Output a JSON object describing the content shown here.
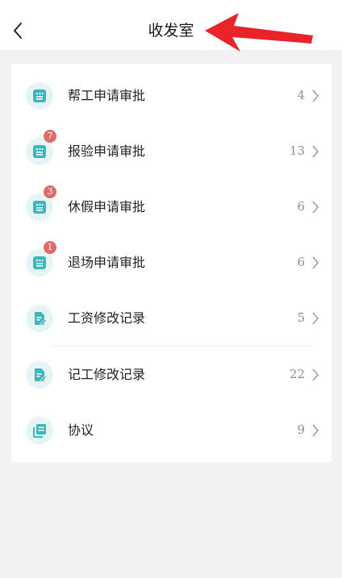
{
  "header": {
    "title": "收发室"
  },
  "items": [
    {
      "label": "帮工申请审批",
      "count": "4",
      "badge": "",
      "icon": "doc-list-icon"
    },
    {
      "label": "报验申请审批",
      "count": "13",
      "badge": "7",
      "icon": "doc-list-icon"
    },
    {
      "label": "休假申请审批",
      "count": "6",
      "badge": "3",
      "icon": "doc-list-icon"
    },
    {
      "label": "退场申请审批",
      "count": "6",
      "badge": "1",
      "icon": "doc-list-icon"
    },
    {
      "label": "工资修改记录",
      "count": "5",
      "badge": "",
      "icon": "doc-edit-icon"
    },
    {
      "label": "记工修改记录",
      "count": "22",
      "badge": "",
      "icon": "doc-edit-icon"
    },
    {
      "label": "协议",
      "count": "9",
      "badge": "",
      "icon": "stacked-docs-icon"
    }
  ],
  "colors": {
    "icon_teal": "#3bb7bd",
    "icon_bg": "#e5f5f5",
    "badge_red": "#e06a6a",
    "annotation_arrow": "#e8242a"
  }
}
